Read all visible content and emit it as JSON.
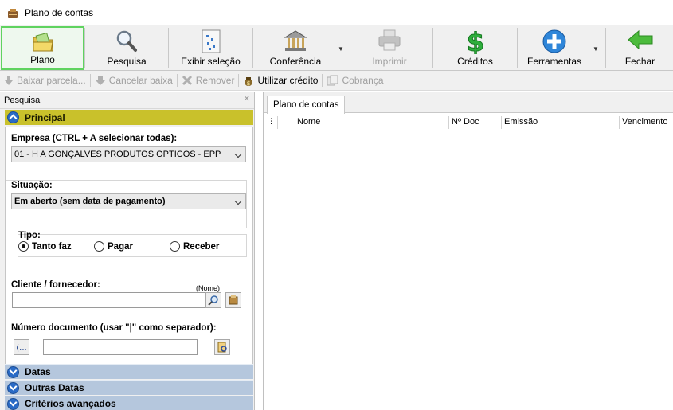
{
  "window": {
    "title": "Plano de contas",
    "icon": "money-bag-icon"
  },
  "toolbar": {
    "buttons": [
      {
        "label": "Plano",
        "icon": "folder-icon",
        "active": true
      },
      {
        "label": "Pesquisa",
        "icon": "magnifier-icon"
      },
      {
        "label": "Exibir seleção",
        "icon": "selection-icon"
      },
      {
        "label": "Conferência",
        "icon": "bank-icon"
      },
      {
        "label": "Imprimir",
        "icon": "printer-icon",
        "disabled": true
      },
      {
        "label": "Créditos",
        "icon": "dollar-icon"
      },
      {
        "label": "Ferramentas",
        "icon": "plus-circle-icon"
      },
      {
        "label": "Fechar",
        "icon": "back-arrow-icon"
      }
    ]
  },
  "actions": {
    "baixar": "Baixar parcela...",
    "cancelar": "Cancelar baixa",
    "remover": "Remover",
    "utilizar": "Utilizar crédito",
    "cobranca": "Cobrança"
  },
  "left_panel": {
    "header": "Pesquisa",
    "principal": {
      "title": "Principal",
      "empresa_label": "Empresa (CTRL + A selecionar todas):",
      "empresa_value": "01 - H A GONÇALVES PRODUTOS OPTICOS - EPP",
      "situacao_label": "Situação:",
      "situacao_value": "Em aberto (sem data de pagamento)",
      "tipo_label": "Tipo:",
      "tipo_options": [
        "Tanto faz",
        "Pagar",
        "Receber"
      ],
      "tipo_selected": "Tanto faz",
      "cliente_label": "Cliente / fornecedor:",
      "cliente_hint": "(Nome)",
      "cliente_value": "",
      "numero_label": "Número documento (usar \"|\" como separador):",
      "numero_value": ""
    },
    "sections": [
      "Datas",
      "Outras Datas",
      "Critérios avançados"
    ]
  },
  "right_panel": {
    "tab": "Plano de contas",
    "columns": [
      "Nome",
      "Nº Doc",
      "Emissão",
      "Vencimento"
    ]
  },
  "colors": {
    "principal_header": "#c9c12b",
    "section_header": "#b5c7dd",
    "active_button_border": "#5fd35f"
  }
}
